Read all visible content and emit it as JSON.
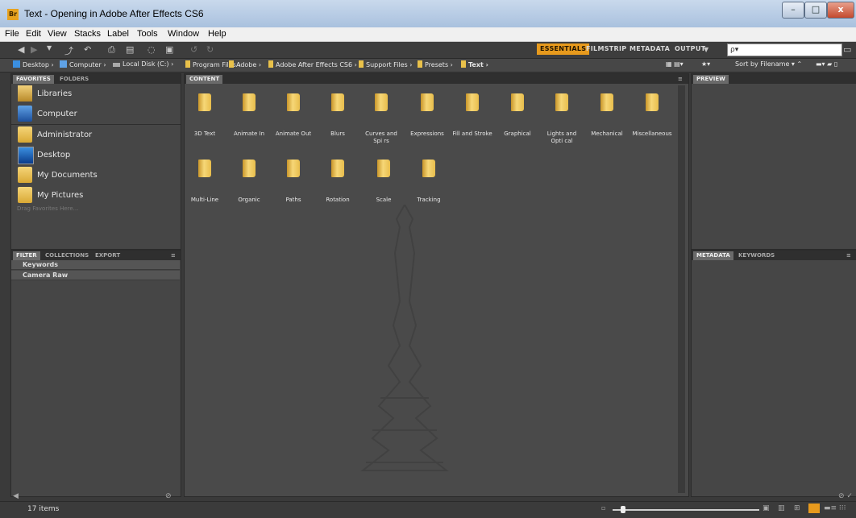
{
  "window": {
    "app_icon_label": "Br",
    "title": "Text - Opening in Adobe After Effects CS6",
    "controls": {
      "minimize": "–",
      "maximize": "□",
      "close": "x"
    }
  },
  "menubar": [
    "File",
    "Edit",
    "View",
    "Stacks",
    "Label",
    "Tools",
    "Window",
    "Help"
  ],
  "workspaces": {
    "essentials": "ESSENTIALS",
    "filmstrip": "FILMSTRIP",
    "metadata": "METADATA",
    "output": "OUTPUT"
  },
  "search": {
    "placeholder": "ρ▾"
  },
  "breadcrumb": [
    "Desktop",
    "Computer",
    "Local Disk (C:)",
    "Program Files",
    "Adobe",
    "Adobe After Effects CS6",
    "Support Files",
    "Presets",
    "Text"
  ],
  "sort_label": "Sort by Filename",
  "left_top_panel": {
    "tabs": [
      "FAVORITES",
      "FOLDERS"
    ],
    "items": [
      "Libraries",
      "Computer",
      "Administrator",
      "Desktop",
      "My Documents",
      "My Pictures"
    ],
    "hint": "Drag Favorites Here..."
  },
  "left_bottom_panel": {
    "tabs": [
      "FILTER",
      "COLLECTIONS",
      "EXPORT"
    ],
    "rows": [
      "Keywords",
      "Camera Raw"
    ]
  },
  "content_panel": {
    "tab": "CONTENT",
    "folders": [
      "3D Text",
      "Animate In",
      "Animate Out",
      "Blurs",
      "Curves and Spi rs",
      "Expressions",
      "Fill and Stroke",
      "Graphical",
      "Lights and Opti cal",
      "Mechanical",
      "Miscellaneous",
      "Multi-Line",
      "Organic",
      "Paths",
      "Rotation",
      "Scale",
      "Tracking"
    ]
  },
  "preview_panel": {
    "tab": "PREVIEW"
  },
  "metadata_panel": {
    "tabs": [
      "METADATA",
      "KEYWORDS"
    ]
  },
  "status": {
    "items_count": "17 items"
  }
}
